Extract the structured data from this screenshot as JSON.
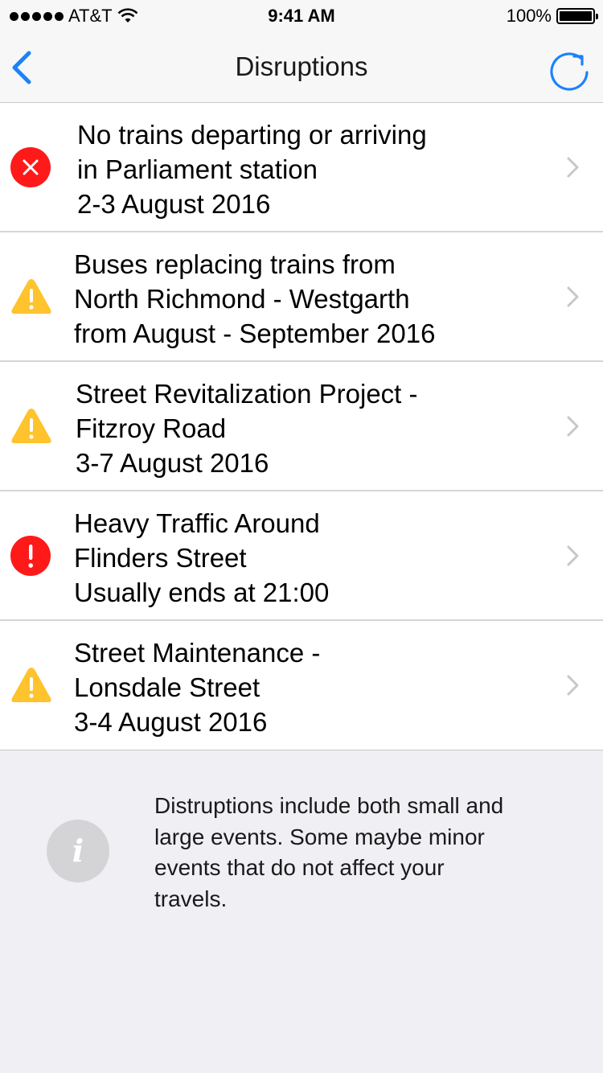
{
  "status_bar": {
    "carrier": "AT&T",
    "time": "9:41 AM",
    "battery": "100%",
    "battery_level": 1.0
  },
  "nav": {
    "title": "Disruptions",
    "back_icon": "chevron-left-icon",
    "refresh_icon": "refresh-icon",
    "accent_color": "#1a82fb"
  },
  "disruptions": [
    {
      "severity": "closed",
      "icon": "x-circle-icon",
      "color": "#ff1a1a",
      "lines": [
        "No trains departing or arriving",
        "in Parliament station",
        "2-3 August 2016"
      ]
    },
    {
      "severity": "warning",
      "icon": "warning-triangle-icon",
      "color": "#fec32d",
      "lines": [
        "Buses replacing trains from",
        "North Richmond - Westgarth",
        "from August - September 2016"
      ]
    },
    {
      "severity": "warning",
      "icon": "warning-triangle-icon",
      "color": "#fec32d",
      "lines": [
        "Street Revitalization Project -",
        "Fitzroy Road",
        "3-7 August 2016"
      ]
    },
    {
      "severity": "alert",
      "icon": "exclamation-circle-icon",
      "color": "#ff1a1a",
      "lines": [
        "Heavy Traffic Around",
        "Flinders Street",
        "Usually ends at 21:00"
      ]
    },
    {
      "severity": "warning",
      "icon": "warning-triangle-icon",
      "color": "#fec32d",
      "lines": [
        "Street Maintenance -",
        "Lonsdale Street",
        "3-4 August 2016"
      ]
    }
  ],
  "info": {
    "icon": "info-icon",
    "icon_glyph": "i",
    "lines": [
      "Distruptions include both small and",
      "large events. Some maybe minor",
      "events that do not affect your",
      "travels."
    ]
  }
}
